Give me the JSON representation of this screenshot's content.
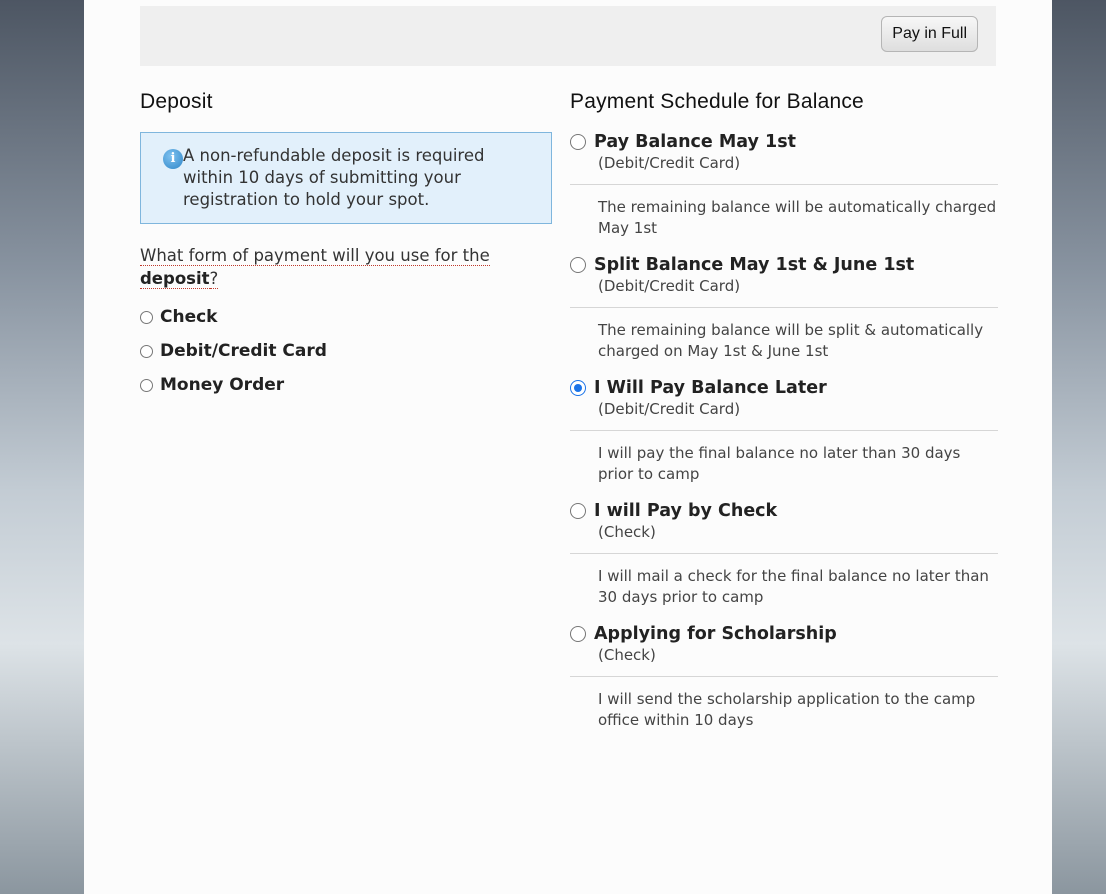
{
  "top_bar": {
    "pay_full_label": "Pay in Full"
  },
  "deposit": {
    "heading": "Deposit",
    "info": "A non-refundable deposit is required within 10 days of submitting your registration to hold your spot.",
    "question_prefix": "What form of payment will you use for the ",
    "question_bold": "deposit",
    "question_suffix": "?",
    "options": [
      "Check",
      "Debit/Credit Card",
      "Money Order"
    ]
  },
  "schedule": {
    "heading": "Payment Schedule for Balance",
    "options": [
      {
        "title": "Pay Balance May 1st",
        "sub": "(Debit/Credit Card)",
        "desc": "The remaining balance will be automatically charged May 1st",
        "checked": false
      },
      {
        "title": "Split Balance May 1st & June 1st",
        "sub": "(Debit/Credit Card)",
        "desc": "The remaining balance will be split & automatically charged on May 1st & June 1st",
        "checked": false
      },
      {
        "title": "I Will Pay Balance Later",
        "sub": "(Debit/Credit Card)",
        "desc": "I will pay the final balance no later than 30 days prior to camp",
        "checked": true
      },
      {
        "title": "I will Pay by Check",
        "sub": "(Check)",
        "desc": "I will mail a check for the final balance no later than 30 days prior to camp",
        "checked": false
      },
      {
        "title": "Applying for Scholarship",
        "sub": "(Check)",
        "desc": "I will send the scholarship application to the camp office within 10 days",
        "checked": false
      }
    ]
  },
  "colors": {
    "accent": "#1a73e8",
    "info_bg": "#e2f0fb",
    "info_border": "#7fb6dd"
  }
}
